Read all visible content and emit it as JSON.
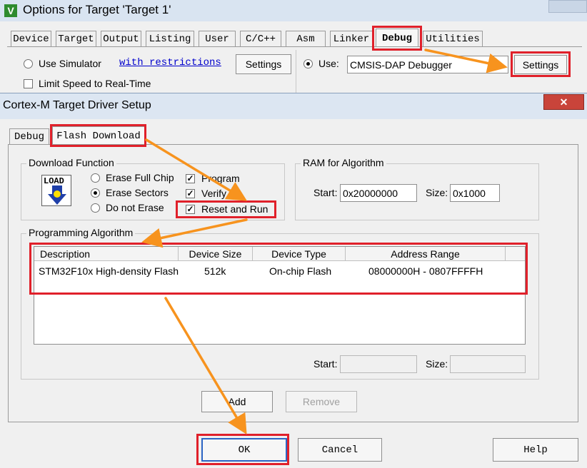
{
  "options_window": {
    "title": "Options for Target 'Target 1'",
    "icon_letter": "V",
    "tabs": [
      "Device",
      "Target",
      "Output",
      "Listing",
      "User",
      "C/C++",
      "Asm",
      "Linker",
      "Debug",
      "Utilities"
    ],
    "use_simulator_label": "Use Simulator",
    "with_restrictions_link": "with restrictions",
    "settings_left_label": "Settings",
    "limit_speed_label": "Limit Speed to Real-Time",
    "use_label": "Use:",
    "debugger_selected": "CMSIS-DAP Debugger",
    "settings_right_label": "Settings"
  },
  "driver_dialog": {
    "title": "Cortex-M Target Driver Setup",
    "close_label": "✕",
    "tabs": [
      "Debug",
      "Flash Download"
    ],
    "download_function": {
      "label": "Download Function",
      "load_icon_text": "LOAD",
      "radio_options": [
        "Erase Full Chip",
        "Erase Sectors",
        "Do not Erase"
      ],
      "selected_option": "Erase Sectors",
      "checkboxes": [
        {
          "label": "Program",
          "checked": true
        },
        {
          "label": "Verify",
          "checked": true
        },
        {
          "label": "Reset and Run",
          "checked": true
        }
      ]
    },
    "ram_for_algorithm": {
      "label": "RAM for Algorithm",
      "start_label": "Start:",
      "start_value": "0x20000000",
      "size_label": "Size:",
      "size_value": "0x1000"
    },
    "programming_algorithm": {
      "label": "Programming Algorithm",
      "columns": [
        "Description",
        "Device Size",
        "Device Type",
        "Address Range"
      ],
      "rows": [
        [
          "STM32F10x High-density Flash",
          "512k",
          "On-chip Flash",
          "08000000H - 0807FFFFH"
        ]
      ],
      "start_label": "Start:",
      "start_value": "",
      "size_label": "Size:",
      "size_value": ""
    },
    "add_label": "Add",
    "remove_label": "Remove",
    "ok_label": "OK",
    "cancel_label": "Cancel",
    "help_label": "Help"
  },
  "colors": {
    "highlight_red": "#e0202a",
    "arrow_orange": "#f7931e",
    "dialog_bg": "#f0f0f0",
    "link_blue": "#0000cc"
  }
}
